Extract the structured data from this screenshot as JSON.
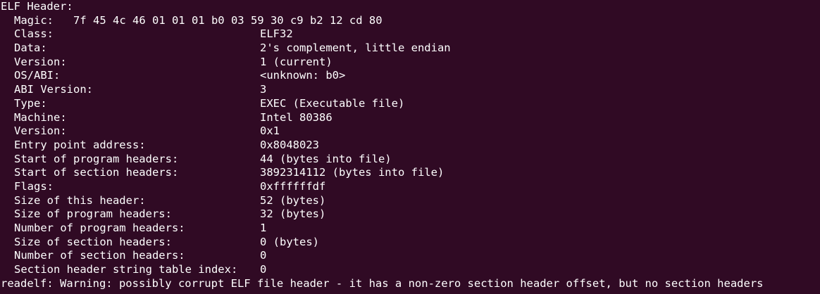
{
  "terminal": {
    "background": "#300a24",
    "foreground": "#ffffff",
    "header_title": "ELF Header:",
    "magic_label": "Magic:",
    "magic_bytes": "7f 45 4c 46 01 01 01 b0 03 59 30 c9 b2 12 cd 80",
    "fields": [
      {
        "name": "Class:",
        "value": "ELF32"
      },
      {
        "name": "Data:",
        "value": "2's complement, little endian"
      },
      {
        "name": "Version:",
        "value": "1 (current)"
      },
      {
        "name": "OS/ABI:",
        "value": "<unknown: b0>"
      },
      {
        "name": "ABI Version:",
        "value": "3"
      },
      {
        "name": "Type:",
        "value": "EXEC (Executable file)"
      },
      {
        "name": "Machine:",
        "value": "Intel 80386"
      },
      {
        "name": "Version:",
        "value": "0x1"
      },
      {
        "name": "Entry point address:",
        "value": "0x8048023"
      },
      {
        "name": "Start of program headers:",
        "value": "44 (bytes into file)"
      },
      {
        "name": "Start of section headers:",
        "value": "3892314112 (bytes into file)"
      },
      {
        "name": "Flags:",
        "value": "0xffffffdf"
      },
      {
        "name": "Size of this header:",
        "value": "52 (bytes)"
      },
      {
        "name": "Size of program headers:",
        "value": "32 (bytes)"
      },
      {
        "name": "Number of program headers:",
        "value": "1"
      },
      {
        "name": "Size of section headers:",
        "value": "0 (bytes)"
      },
      {
        "name": "Number of section headers:",
        "value": "0"
      },
      {
        "name": "Section header string table index:",
        "value": "0"
      }
    ],
    "warning": "readelf: Warning: possibly corrupt ELF file header - it has a non-zero section header offset, but no section headers"
  }
}
